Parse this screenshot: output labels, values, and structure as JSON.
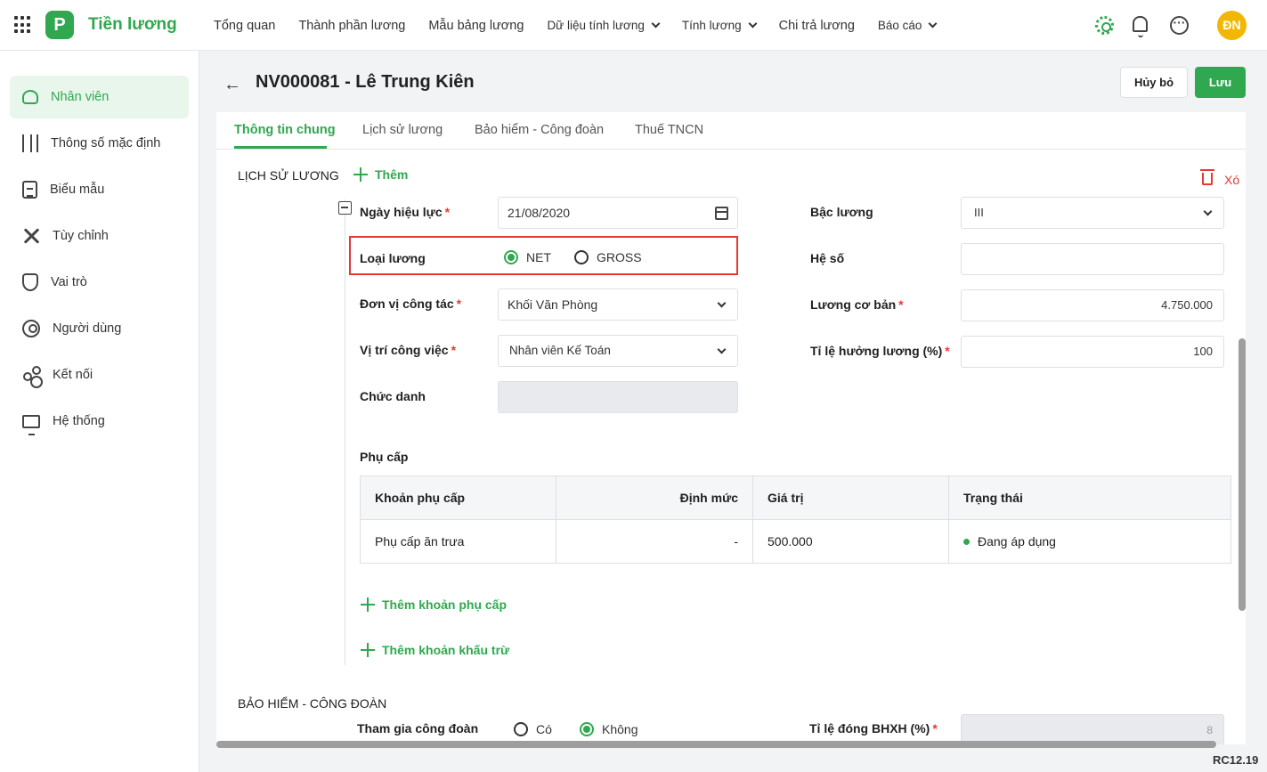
{
  "app": {
    "logo_letter": "P",
    "name": "Tiền lương",
    "user_initials": "ĐN"
  },
  "nav": {
    "items": [
      {
        "label": "Tổng quan",
        "dropdown": false
      },
      {
        "label": "Thành phần lương",
        "dropdown": false
      },
      {
        "label": "Mẫu bảng lương",
        "dropdown": false
      },
      {
        "label": "Dữ liệu tính lương",
        "dropdown": true
      },
      {
        "label": "Tính lương",
        "dropdown": true
      },
      {
        "label": "Chi trả lương",
        "dropdown": false
      },
      {
        "label": "Báo cáo",
        "dropdown": true
      }
    ]
  },
  "sidebar": {
    "items": [
      {
        "label": "Nhân viên",
        "icon": "people-icon",
        "active": true
      },
      {
        "label": "Thông số mặc định",
        "icon": "sliders-icon"
      },
      {
        "label": "Biểu mẫu",
        "icon": "document-icon"
      },
      {
        "label": "Tùy chỉnh",
        "icon": "tools-icon"
      },
      {
        "label": "Vai trò",
        "icon": "shield-icon"
      },
      {
        "label": "Người dùng",
        "icon": "user-icon"
      },
      {
        "label": "Kết nối",
        "icon": "share-icon"
      },
      {
        "label": "Hệ thống",
        "icon": "monitor-icon"
      }
    ]
  },
  "header": {
    "back_arrow": "←",
    "title": "NV000081 - Lê Trung Kiên",
    "cancel_label": "Hủy bỏ",
    "save_label": "Lưu"
  },
  "tabs": [
    {
      "label": "Thông tin chung",
      "active": true
    },
    {
      "label": "Lịch sử lương"
    },
    {
      "label": "Bảo hiểm - Công đoàn"
    },
    {
      "label": "Thuế TNCN"
    }
  ],
  "salary_history": {
    "section_title": "LỊCH SỬ LƯƠNG",
    "add_label": "Thêm",
    "delete_label": "Xó",
    "effective_date": {
      "label": "Ngày hiệu lực",
      "value": "21/08/2020",
      "required": "*"
    },
    "salary_type": {
      "label": "Loại lương",
      "options": [
        "NET",
        "GROSS"
      ],
      "selected": "NET"
    },
    "unit": {
      "label": "Đơn vị công tác",
      "value": "Khối Văn Phòng",
      "required": "*"
    },
    "position": {
      "label": "Vị trí công việc",
      "value": "Nhân viên Kế Toán",
      "required": "*"
    },
    "title_field": {
      "label": "Chức danh",
      "value": ""
    },
    "salary_grade": {
      "label": "Bậc lương",
      "value": "III"
    },
    "coefficient": {
      "label": "Hệ số",
      "value": ""
    },
    "base_salary": {
      "label": "Lương cơ bản",
      "value": "4.750.000",
      "required": "*"
    },
    "salary_rate": {
      "label": "Tỉ lệ hưởng lương (%)",
      "value": "100",
      "required": "*"
    },
    "allowance": {
      "title": "Phụ cấp",
      "columns": [
        "Khoản phụ cấp",
        "Định mức",
        "Giá trị",
        "Trạng thái"
      ],
      "rows": [
        {
          "name": "Phụ cấp ăn trưa",
          "norm": "-",
          "value": "500.000",
          "status": "Đang áp dụng"
        }
      ],
      "add_allowance_label": "Thêm khoản phụ cấp",
      "add_deduction_label": "Thêm khoản khấu trừ"
    }
  },
  "insurance": {
    "section_title": "BẢO HIỂM - CÔNG ĐOÀN",
    "union": {
      "label": "Tham gia công đoàn",
      "options": [
        "Có",
        "Không"
      ],
      "selected": "Không"
    },
    "bhxh_rate": {
      "label": "Tỉ lệ đóng BHXH (%)",
      "value": "8",
      "required": "*"
    }
  },
  "version": "RC12.19",
  "colors": {
    "primary": "#2fa84f",
    "danger": "#e53935",
    "avatar": "#f2b705"
  }
}
